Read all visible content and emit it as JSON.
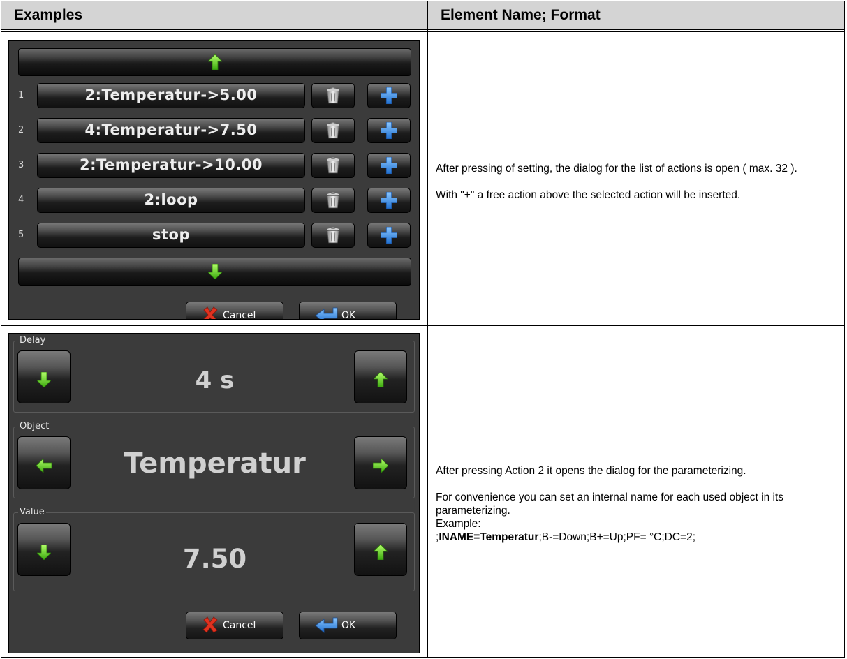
{
  "table": {
    "header_left": "Examples",
    "header_right": "Element Name; Format"
  },
  "row1": {
    "actions": [
      {
        "num": "1",
        "label": "2:Temperatur->5.00"
      },
      {
        "num": "2",
        "label": "4:Temperatur->7.50"
      },
      {
        "num": "3",
        "label": "2:Temperatur->10.00"
      },
      {
        "num": "4",
        "label": "2:loop"
      },
      {
        "num": "5",
        "label": "stop"
      }
    ],
    "cancel_label": "Cancel",
    "ok_label": "OK",
    "desc_p1": "After pressing of setting, the dialog for the list of actions is open ( max. 32 ).",
    "desc_p2": "With \"+\" a free action above the selected action will be inserted."
  },
  "row2": {
    "delay_label": "Delay",
    "delay_value": "4 s",
    "object_label": "Object",
    "object_value": "Temperatur",
    "value_label": "Value",
    "value_value": "7.50",
    "cancel_label": "Cancel",
    "ok_label": "OK",
    "desc_p1": "After pressing Action 2 it opens the dialog for the parameterizing.",
    "desc_p2": "For convenience you can set an internal name for each used object in its parameterizing.",
    "desc_example_label": "Example:",
    "desc_example_prefix": ";",
    "desc_example_bold": "INAME=Temperatur",
    "desc_example_rest": ";B-=Down;B+=Up;PF= °C;DC=2;"
  },
  "icons": {
    "up": "green-up-arrow-icon",
    "down": "green-down-arrow-icon",
    "left": "green-left-arrow-icon",
    "right": "green-right-arrow-icon",
    "trash": "trash-can-icon",
    "plus": "blue-plus-icon",
    "cancel": "red-x-icon",
    "ok": "blue-enter-arrow-icon"
  },
  "colors": {
    "arrow_green": "#6fdc2a",
    "plus_blue": "#3a8fe0",
    "cancel_red": "#d62a1e",
    "screen_bg": "#3b3b3b",
    "header_bg": "#d4d4d4"
  }
}
